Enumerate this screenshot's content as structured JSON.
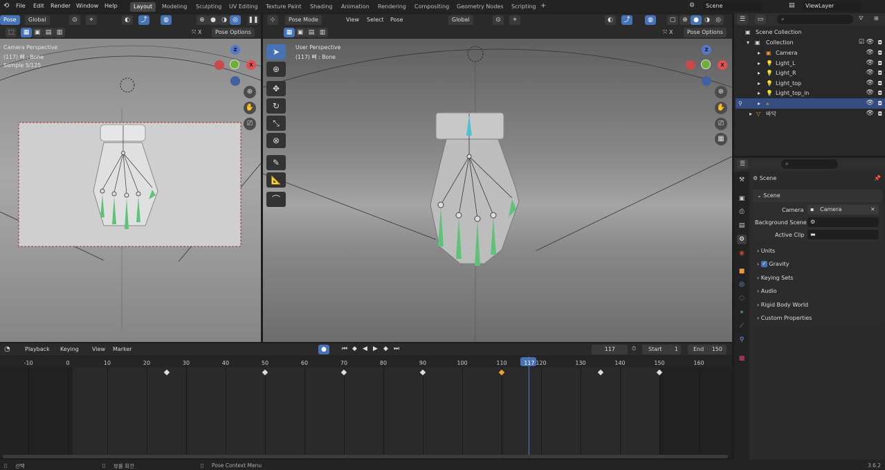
{
  "topbar": {
    "menus": [
      "File",
      "Edit",
      "Render",
      "Window",
      "Help"
    ],
    "workspaces": [
      "Layout",
      "Modeling",
      "Sculpting",
      "UV Editing",
      "Texture Paint",
      "Shading",
      "Animation",
      "Rendering",
      "Compositing",
      "Geometry Nodes",
      "Scripting"
    ],
    "active_workspace": "Layout",
    "scene": "Scene",
    "view_layer": "ViewLayer",
    "add_tab": "+"
  },
  "left_viewport": {
    "mode": "Pose",
    "orientation": "Global",
    "pose_options": "Pose Options",
    "hud": [
      "Camera Perspective",
      "(117) 뼈 : Bone",
      "Sample 5/125"
    ],
    "nav": {
      "z": "Z",
      "x": "X"
    }
  },
  "right_viewport": {
    "mode": "Pose Mode",
    "menus": [
      "View",
      "Select",
      "Pose"
    ],
    "orientation": "Global",
    "pose_options": "Pose Options",
    "hud": [
      "User Perspective",
      "(117) 뼈 : Bone"
    ],
    "nav": {
      "z": "Z",
      "x": "X"
    }
  },
  "outliner": {
    "title": "Scene Collection",
    "items": [
      {
        "label": "Collection",
        "indent": 1
      },
      {
        "label": "Camera",
        "indent": 2
      },
      {
        "label": "Light_L",
        "indent": 2
      },
      {
        "label": "Light_R",
        "indent": 2
      },
      {
        "label": "Light_top",
        "indent": 2
      },
      {
        "label": "Light_top_in",
        "indent": 2
      },
      {
        "label": "",
        "indent": 2,
        "selected": true
      },
      {
        "label": "바닥",
        "indent": 1
      }
    ]
  },
  "properties": {
    "section": "Scene",
    "panel": "Scene",
    "camera_label": "Camera",
    "camera_value": "Camera",
    "bg_label": "Background Scene",
    "clip_label": "Active Clip",
    "subpanels": [
      "Units",
      "Gravity",
      "Keying Sets",
      "Audio",
      "Rigid Body World",
      "Custom Properties"
    ]
  },
  "timeline": {
    "menus": [
      "Playback",
      "Keying",
      "View",
      "Marker"
    ],
    "current_frame": "117",
    "start_label": "Start",
    "start": "1",
    "end_label": "End",
    "end": "150",
    "ticks": [
      "-10",
      "0",
      "10",
      "20",
      "30",
      "40",
      "50",
      "60",
      "70",
      "80",
      "90",
      "100",
      "110",
      "117",
      "120",
      "130",
      "140",
      "150",
      "160"
    ],
    "keyframes": [
      25,
      50,
      70,
      90,
      110,
      135,
      150
    ],
    "selected_keyframe": 110
  },
  "status": {
    "left": "선택",
    "mid": "뷰를 회전",
    "right": "Pose Context Menu",
    "version": "3.6.2"
  }
}
